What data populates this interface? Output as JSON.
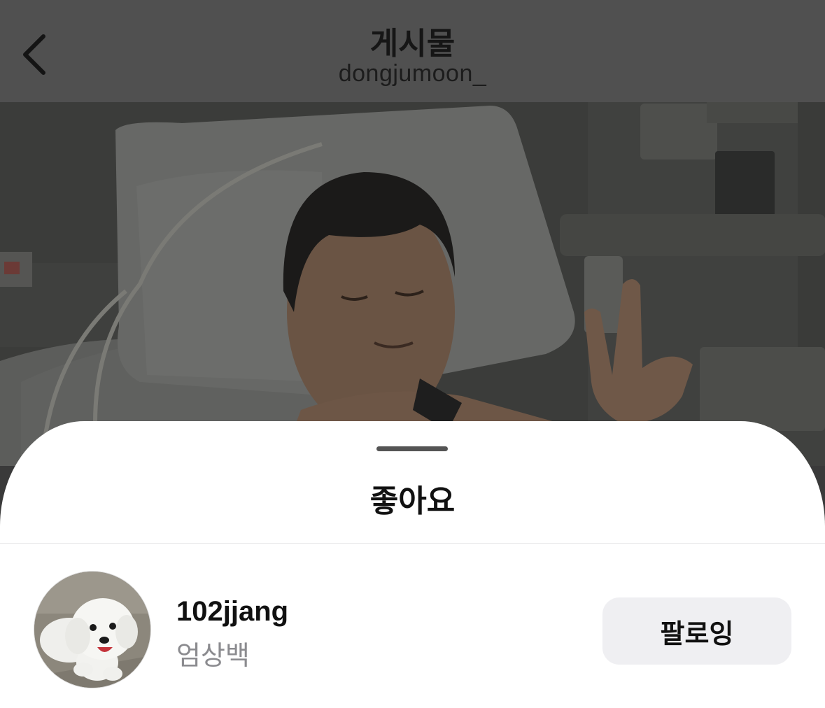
{
  "header": {
    "title": "게시물",
    "subtitle": "dongjumoon_",
    "back_icon": "chevron-left-icon"
  },
  "likes_sheet": {
    "title": "좋아요",
    "users": [
      {
        "username": "102jjang",
        "full_name": "엄상백",
        "follow_label": "팔로잉",
        "avatar": "white dog profile photo"
      }
    ]
  },
  "colors": {
    "dim_overlay": "#505050",
    "sheet_background": "#ffffff",
    "follow_button_bg": "#efeff2",
    "secondary_text": "#8b8b8f"
  }
}
